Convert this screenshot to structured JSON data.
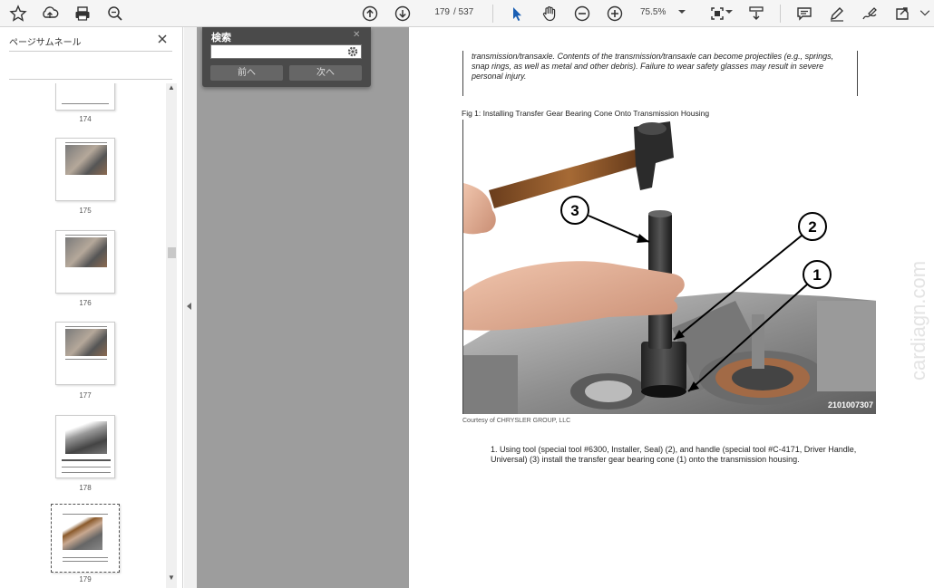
{
  "toolbar": {
    "icons": [
      "star-icon",
      "upload-icon",
      "print-icon",
      "zoom-search-icon",
      "arrow-up-circle-icon",
      "arrow-down-circle-icon",
      "cursor-icon",
      "hand-icon",
      "zoom-out-icon",
      "zoom-in-icon",
      "fit-page-icon",
      "scroll-mode-icon",
      "comment-icon",
      "pen-icon",
      "sign-icon",
      "share-icon"
    ],
    "page_current": "179",
    "page_total": "/ 537",
    "zoom": "75.5%"
  },
  "sidebar": {
    "title": "ページサムネール",
    "thumbnails": [
      {
        "label": "174"
      },
      {
        "label": "175"
      },
      {
        "label": "176"
      },
      {
        "label": "177"
      },
      {
        "label": "178"
      },
      {
        "label": "179"
      }
    ]
  },
  "search": {
    "title": "検索",
    "input_value": "",
    "prev_label": "前へ",
    "next_label": "次へ"
  },
  "page": {
    "warning_text": "transmission/transaxle. Contents of the transmission/transaxle can become projectiles (e.g., springs, snap rings, as well as metal and other debris). Failure to wear safety glasses may result in severe personal injury.",
    "figure_caption": "Fig 1: Installing Transfer Gear Bearing Cone Onto Transmission Housing",
    "figure_callouts": [
      "3",
      "2",
      "1"
    ],
    "figure_code": "2101007307",
    "courtesy": "Courtesy of CHRYSLER GROUP, LLC",
    "step1": "1. Using tool (special tool #6300, Installer, Seal) (2), and handle (special tool #C-4171, Driver Handle, Universal) (3) install the transfer gear bearing cone (1) onto the transmission housing.",
    "watermark": "cardiagn.com"
  },
  "colors": {
    "toolbar_bg": "#f5f5f5",
    "doc_bg": "#9d9d9d",
    "search_panel_bg": "#4a4a4a",
    "cursor_blue": "#1a5fb4"
  }
}
